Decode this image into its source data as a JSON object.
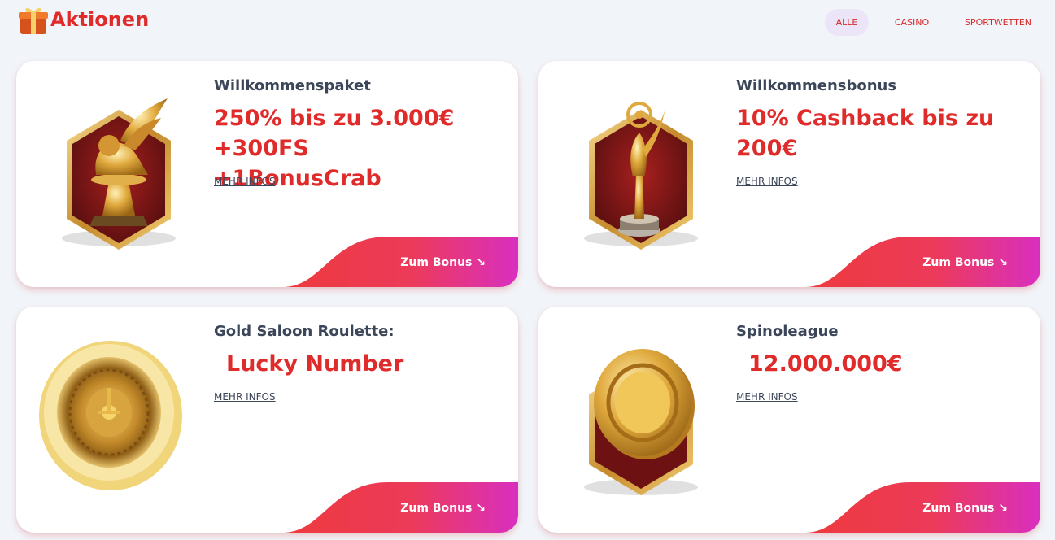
{
  "header": {
    "title": "Aktionen",
    "logo_icon": "gift-box-icon",
    "tabs": [
      {
        "label": "ALLE",
        "active": true
      },
      {
        "label": "CASINO",
        "active": false
      },
      {
        "label": "SPORTWETTEN",
        "active": false
      }
    ]
  },
  "colors": {
    "accent": "#e02b2b",
    "text_dark": "#3c4659",
    "button_gradient_start": "#ee3a3c",
    "button_gradient_end": "#d92fc0",
    "active_tab_bg": "#ebe5f7",
    "page_bg": "#f1f4f9"
  },
  "cards": [
    {
      "subtitle": "Willkommenspaket",
      "headline": "250% bis zu 3.000€\n+300FS +1BonusCrab",
      "link": "MEHR INFOS",
      "button": "Zum Bonus ↘",
      "image_icon": "winged-lion-trophy-icon"
    },
    {
      "subtitle": "Willkommensbonus",
      "headline": "10% Cashback bis zu\n200€",
      "link": "MEHR INFOS",
      "button": "Zum Bonus ↘",
      "image_icon": "statuette-trophy-icon"
    },
    {
      "subtitle": "Gold Saloon Roulette:",
      "headline": "Lucky Number",
      "link": "MEHR INFOS",
      "button": "Zum Bonus ↘",
      "image_icon": "roulette-wheel-icon"
    },
    {
      "subtitle": "Spinoleague",
      "headline": "12.000.000€",
      "link": "MEHR INFOS",
      "button": "Zum Bonus ↘",
      "image_icon": "gold-chip-icon"
    }
  ]
}
